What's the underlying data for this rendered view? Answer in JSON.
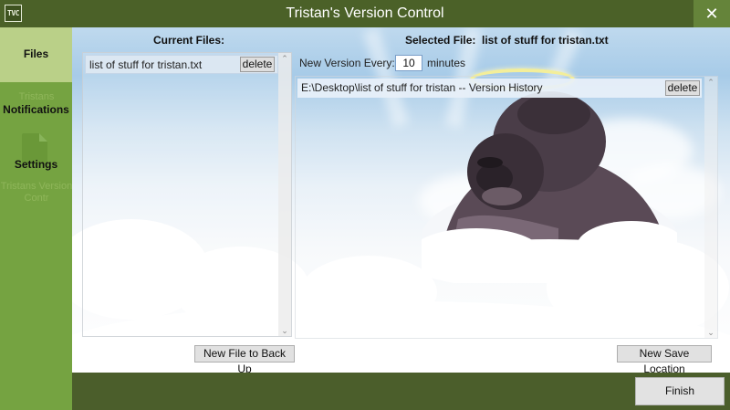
{
  "window": {
    "title": "Tristan's Version Control",
    "logo_text": "TVC",
    "close_symbol": "✕"
  },
  "sidebar": {
    "items": [
      {
        "label": "Files",
        "icon": "files-icon",
        "selected": true
      },
      {
        "label": "Notifications",
        "ghost": "Tristans",
        "icon": "bell-icon",
        "selected": false
      },
      {
        "label": "Settings",
        "ghost": "Tristans Version Contr",
        "icon": "document-icon",
        "selected": false
      }
    ]
  },
  "files_panel": {
    "header": "Current Files:",
    "files": [
      {
        "name": "list of stuff for tristan.txt",
        "delete_label": "delete"
      }
    ],
    "new_file_button": "New File to Back Up"
  },
  "selected_panel": {
    "header_label": "Selected File:",
    "file_name": "list of stuff for tristan.txt",
    "version_every_label": "New Version Every:",
    "version_every_value": "10",
    "version_every_unit": "minutes",
    "history": [
      {
        "path": "E:\\Desktop\\list of stuff for tristan -- Version History",
        "delete_label": "delete"
      }
    ],
    "new_save_location_button": "New Save Location"
  },
  "footer": {
    "finish_label": "Finish"
  },
  "colors": {
    "titlebar": "#4b6128",
    "sidebar": "#75a341",
    "sidebar_selected": "#bad088",
    "close_button": "#65843a",
    "footer": "#4b5e2b"
  }
}
